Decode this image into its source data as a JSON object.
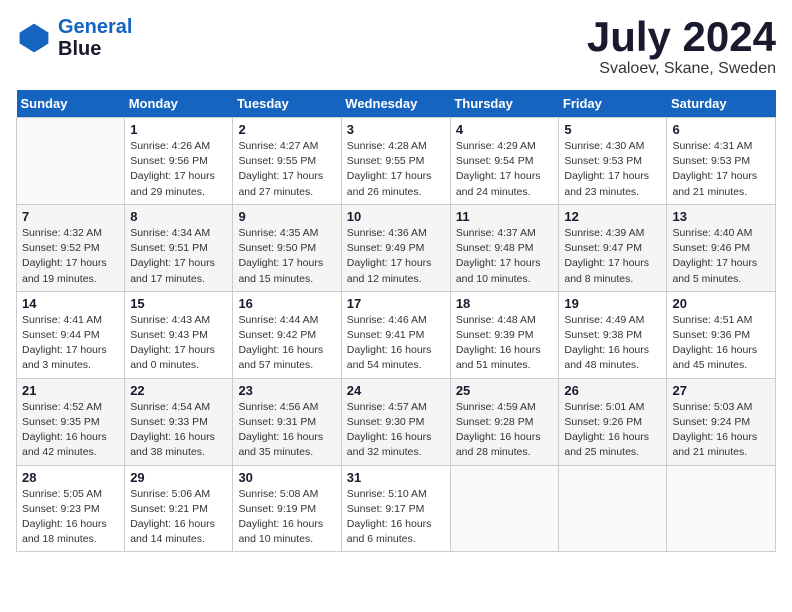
{
  "header": {
    "logo_line1": "General",
    "logo_line2": "Blue",
    "month_year": "July 2024",
    "location": "Svaloev, Skane, Sweden"
  },
  "weekdays": [
    "Sunday",
    "Monday",
    "Tuesday",
    "Wednesday",
    "Thursday",
    "Friday",
    "Saturday"
  ],
  "weeks": [
    [
      {
        "day": "",
        "info": ""
      },
      {
        "day": "1",
        "info": "Sunrise: 4:26 AM\nSunset: 9:56 PM\nDaylight: 17 hours\nand 29 minutes."
      },
      {
        "day": "2",
        "info": "Sunrise: 4:27 AM\nSunset: 9:55 PM\nDaylight: 17 hours\nand 27 minutes."
      },
      {
        "day": "3",
        "info": "Sunrise: 4:28 AM\nSunset: 9:55 PM\nDaylight: 17 hours\nand 26 minutes."
      },
      {
        "day": "4",
        "info": "Sunrise: 4:29 AM\nSunset: 9:54 PM\nDaylight: 17 hours\nand 24 minutes."
      },
      {
        "day": "5",
        "info": "Sunrise: 4:30 AM\nSunset: 9:53 PM\nDaylight: 17 hours\nand 23 minutes."
      },
      {
        "day": "6",
        "info": "Sunrise: 4:31 AM\nSunset: 9:53 PM\nDaylight: 17 hours\nand 21 minutes."
      }
    ],
    [
      {
        "day": "7",
        "info": "Sunrise: 4:32 AM\nSunset: 9:52 PM\nDaylight: 17 hours\nand 19 minutes."
      },
      {
        "day": "8",
        "info": "Sunrise: 4:34 AM\nSunset: 9:51 PM\nDaylight: 17 hours\nand 17 minutes."
      },
      {
        "day": "9",
        "info": "Sunrise: 4:35 AM\nSunset: 9:50 PM\nDaylight: 17 hours\nand 15 minutes."
      },
      {
        "day": "10",
        "info": "Sunrise: 4:36 AM\nSunset: 9:49 PM\nDaylight: 17 hours\nand 12 minutes."
      },
      {
        "day": "11",
        "info": "Sunrise: 4:37 AM\nSunset: 9:48 PM\nDaylight: 17 hours\nand 10 minutes."
      },
      {
        "day": "12",
        "info": "Sunrise: 4:39 AM\nSunset: 9:47 PM\nDaylight: 17 hours\nand 8 minutes."
      },
      {
        "day": "13",
        "info": "Sunrise: 4:40 AM\nSunset: 9:46 PM\nDaylight: 17 hours\nand 5 minutes."
      }
    ],
    [
      {
        "day": "14",
        "info": "Sunrise: 4:41 AM\nSunset: 9:44 PM\nDaylight: 17 hours\nand 3 minutes."
      },
      {
        "day": "15",
        "info": "Sunrise: 4:43 AM\nSunset: 9:43 PM\nDaylight: 17 hours\nand 0 minutes."
      },
      {
        "day": "16",
        "info": "Sunrise: 4:44 AM\nSunset: 9:42 PM\nDaylight: 16 hours\nand 57 minutes."
      },
      {
        "day": "17",
        "info": "Sunrise: 4:46 AM\nSunset: 9:41 PM\nDaylight: 16 hours\nand 54 minutes."
      },
      {
        "day": "18",
        "info": "Sunrise: 4:48 AM\nSunset: 9:39 PM\nDaylight: 16 hours\nand 51 minutes."
      },
      {
        "day": "19",
        "info": "Sunrise: 4:49 AM\nSunset: 9:38 PM\nDaylight: 16 hours\nand 48 minutes."
      },
      {
        "day": "20",
        "info": "Sunrise: 4:51 AM\nSunset: 9:36 PM\nDaylight: 16 hours\nand 45 minutes."
      }
    ],
    [
      {
        "day": "21",
        "info": "Sunrise: 4:52 AM\nSunset: 9:35 PM\nDaylight: 16 hours\nand 42 minutes."
      },
      {
        "day": "22",
        "info": "Sunrise: 4:54 AM\nSunset: 9:33 PM\nDaylight: 16 hours\nand 38 minutes."
      },
      {
        "day": "23",
        "info": "Sunrise: 4:56 AM\nSunset: 9:31 PM\nDaylight: 16 hours\nand 35 minutes."
      },
      {
        "day": "24",
        "info": "Sunrise: 4:57 AM\nSunset: 9:30 PM\nDaylight: 16 hours\nand 32 minutes."
      },
      {
        "day": "25",
        "info": "Sunrise: 4:59 AM\nSunset: 9:28 PM\nDaylight: 16 hours\nand 28 minutes."
      },
      {
        "day": "26",
        "info": "Sunrise: 5:01 AM\nSunset: 9:26 PM\nDaylight: 16 hours\nand 25 minutes."
      },
      {
        "day": "27",
        "info": "Sunrise: 5:03 AM\nSunset: 9:24 PM\nDaylight: 16 hours\nand 21 minutes."
      }
    ],
    [
      {
        "day": "28",
        "info": "Sunrise: 5:05 AM\nSunset: 9:23 PM\nDaylight: 16 hours\nand 18 minutes."
      },
      {
        "day": "29",
        "info": "Sunrise: 5:06 AM\nSunset: 9:21 PM\nDaylight: 16 hours\nand 14 minutes."
      },
      {
        "day": "30",
        "info": "Sunrise: 5:08 AM\nSunset: 9:19 PM\nDaylight: 16 hours\nand 10 minutes."
      },
      {
        "day": "31",
        "info": "Sunrise: 5:10 AM\nSunset: 9:17 PM\nDaylight: 16 hours\nand 6 minutes."
      },
      {
        "day": "",
        "info": ""
      },
      {
        "day": "",
        "info": ""
      },
      {
        "day": "",
        "info": ""
      }
    ]
  ]
}
